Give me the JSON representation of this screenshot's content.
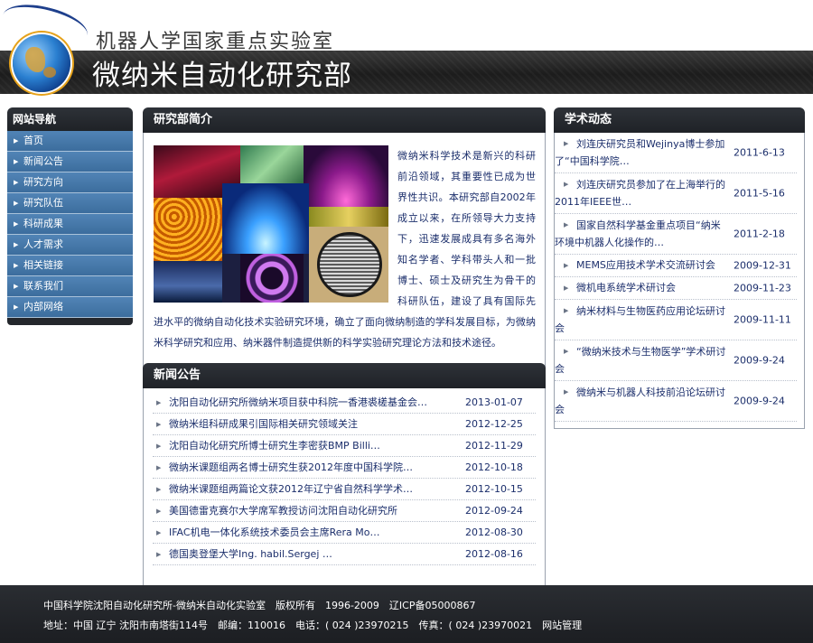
{
  "header": {
    "lab_title": "机器人学国家重点实验室",
    "dept_title": "微纳米自动化研究部",
    "logo_icon": "globe-logo-icon"
  },
  "nav": {
    "title": "网站导航",
    "items": [
      {
        "label": "首页"
      },
      {
        "label": "新闻公告"
      },
      {
        "label": "研究方向"
      },
      {
        "label": "研究队伍"
      },
      {
        "label": "科研成果"
      },
      {
        "label": "人才需求"
      },
      {
        "label": "相关链接"
      },
      {
        "label": "联系我们"
      },
      {
        "label": "内部网络"
      }
    ]
  },
  "intro": {
    "title": "研究部简介",
    "text": "微纳米科学技术是新兴的科研前沿领域，其重要性已成为世界性共识。本研究部自2002年成立以来，在所领导大力支持下，迅速发展成具有多名海外知名学者、学科带头人和一批博士、硕士及研究生为骨干的科研队伍，建设了具有国际先进水平的微纳自动化技术实验研究环境，确立了面向微纳制造的学科发展目标，为微纳米科学研究和应用、纳米器件制造提供新的科学实验研究理论方法和技术途径。"
  },
  "news": {
    "title": "新闻公告",
    "items": [
      {
        "title": "沈阳自动化研究所微纳米项目获中科院一香港裘槎基金会…",
        "date": "2013-01-07"
      },
      {
        "title": "微纳米组科研成果引国际相关研究领域关注",
        "date": "2012-12-25"
      },
      {
        "title": "沈阳自动化研究所博士研究生李密获BMP Billi…",
        "date": "2012-11-29"
      },
      {
        "title": "微纳米课题组两名博士研究生获2012年度中国科学院…",
        "date": "2012-10-18"
      },
      {
        "title": "微纳米课题组两篇论文获2012年辽宁省自然科学学术…",
        "date": "2012-10-15"
      },
      {
        "title": "美国德雷克赛尔大学席军教授访问沈阳自动化研究所",
        "date": "2012-09-24"
      },
      {
        "title": "IFAC机电一体化系统技术委员会主席Rera Mo…",
        "date": "2012-08-30"
      },
      {
        "title": "德国奥登堡大学Ing. habil.Sergej …",
        "date": "2012-08-16"
      }
    ]
  },
  "academic": {
    "title": "学术动态",
    "items": [
      {
        "title": "刘连庆研究员和Wejinya博士参加了“中国科学院…",
        "date": "2011-6-13"
      },
      {
        "title": "刘连庆研究员参加了在上海举行的2011年IEEE世…",
        "date": "2011-5-16"
      },
      {
        "title": "国家自然科学基金重点项目“纳米环境中机器人化操作的…",
        "date": "2011-2-18"
      },
      {
        "title": "MEMS应用技术学术交流研讨会",
        "date": "2009-12-31"
      },
      {
        "title": "微机电系统学术研讨会",
        "date": "2009-11-23"
      },
      {
        "title": "纳米材料与生物医药应用论坛研讨会",
        "date": "2009-11-11"
      },
      {
        "title": "“微纳米技术与生物医学”学术研讨会",
        "date": "2009-9-24"
      },
      {
        "title": "微纳米与机器人科技前沿论坛研讨会",
        "date": "2009-9-24"
      }
    ]
  },
  "footer": {
    "line1": "中国科学院沈阳自动化研究所-微纳米自动化实验室　版权所有　1996-2009　辽ICP备05000867",
    "line2_prefix": "地址：中国 辽宁 沈阳市南塔街114号　邮编：110016　电话：( 024 )23970215　传真：( 024 )23970021　",
    "admin_link": "网站管理"
  }
}
